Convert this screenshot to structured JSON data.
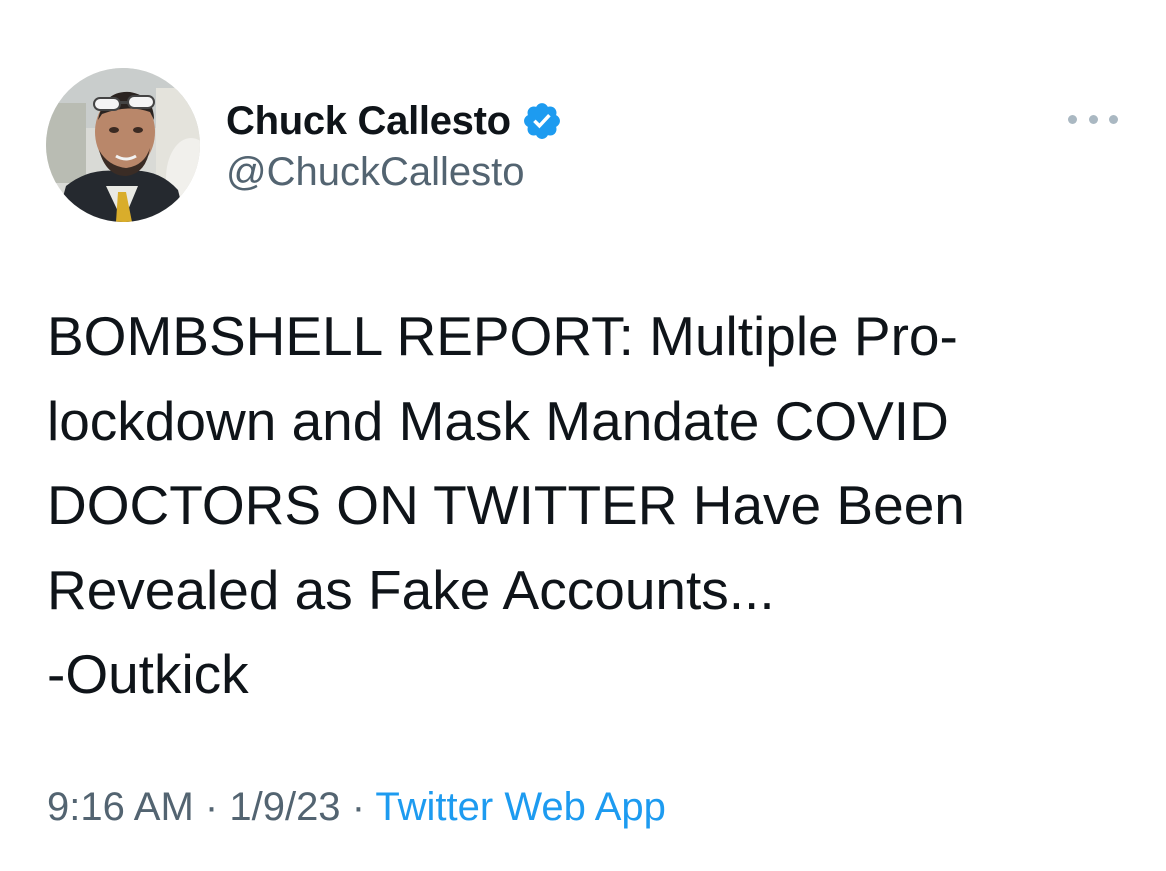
{
  "tweet": {
    "author": {
      "display_name": "Chuck Callesto",
      "handle": "@ChuckCallesto",
      "verified": true,
      "verified_badge_icon": "verified-check-icon",
      "avatar_icon": "profile-photo-avatar"
    },
    "more_options_icon": "more-horizontal-icon",
    "text_lines": [
      "BOMBSHELL REPORT: Multiple Pro-",
      "lockdown and Mask Mandate COVID",
      "DOCTORS ON TWITTER Have Been",
      "Revealed as Fake Accounts...",
      "-Outkick"
    ],
    "time": "9:16 AM",
    "date": "1/9/23",
    "separator": "·",
    "source": "Twitter Web App"
  },
  "colors": {
    "text_primary": "#0f1419",
    "text_secondary": "#536471",
    "accent": "#1d9bf0",
    "icon_muted": "#aab8c2"
  }
}
